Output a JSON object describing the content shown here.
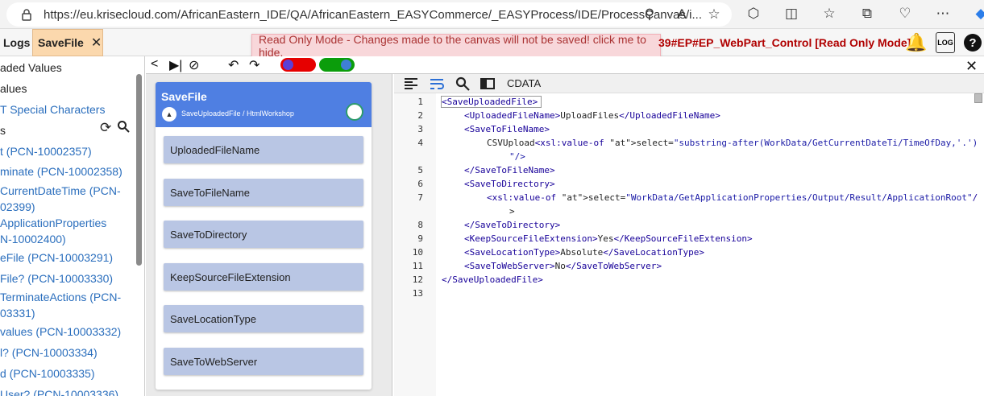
{
  "browser": {
    "url": "https://eu.krisecloud.com/AfricanEastern_IDE/QA/AfricanEastern_EASYCommerce/_EASYProcess/IDE/ProcessCanvas/i..."
  },
  "tabs": {
    "logs": "Logs",
    "savefile": "SaveFile",
    "close": "✕"
  },
  "banner": {
    "message": "Read Only Mode - Changes made to the canvas will not be saved! click me to hide.",
    "title_suffix": "39#EP#EP_WebPart_Control [Read Only Mode]"
  },
  "sidebar": {
    "items": [
      "aded Values",
      "alues",
      "T Special Characters",
      "s",
      "t (PCN-10002357)",
      "minate (PCN-10002358)",
      "CurrentDateTime (PCN-",
      "02399)",
      "ApplicationProperties",
      "N-10002400)",
      "eFile (PCN-10003291)",
      "File? (PCN-10003330)",
      "TerminateActions (PCN-",
      "03331)",
      "values (PCN-10003332)",
      "l? (PCN-10003334)",
      "d (PCN-10003335)",
      "User? (PCN-10003336)"
    ]
  },
  "node": {
    "title": "SaveFile",
    "subtitle": "SaveUploadedFile / HtmlWorkshop",
    "fields": [
      "UploadedFileName",
      "SaveToFileName",
      "SaveToDirectory",
      "KeepSourceFileExtension",
      "SaveLocationType",
      "SaveToWebServer"
    ]
  },
  "editor": {
    "cdata_label": "CDATA",
    "line_numbers": [
      "1",
      "2",
      "3",
      "4",
      "",
      "5",
      "6",
      "7",
      "",
      "8",
      "9",
      "10",
      "11",
      "12",
      "13"
    ],
    "lines": [
      {
        "t": "<SaveUploadedFile>",
        "i": 0
      },
      {
        "t": "<UploadedFileName>UploadFiles</UploadedFileName>",
        "i": 1
      },
      {
        "t": "<SaveToFileName>",
        "i": 1
      },
      {
        "t": "CSVUpload<xsl:value-of select=\"substring-after(WorkData/GetCurrentDateTi/TimeOfDay,'.')",
        "i": 2
      },
      {
        "t": "\"/>",
        "i": 3
      },
      {
        "t": "</SaveToFileName>",
        "i": 1
      },
      {
        "t": "<SaveToDirectory>",
        "i": 1
      },
      {
        "t": "<xsl:value-of select=\"WorkData/GetApplicationProperties/Output/Result/ApplicationRoot\"/",
        "i": 2
      },
      {
        "t": ">",
        "i": 3
      },
      {
        "t": "</SaveToDirectory>",
        "i": 1
      },
      {
        "t": "<KeepSourceFileExtension>Yes</KeepSourceFileExtension>",
        "i": 1
      },
      {
        "t": "<SaveLocationType>Absolute</SaveLocationType>",
        "i": 1
      },
      {
        "t": "<SaveToWebServer>No</SaveToWebServer>",
        "i": 1
      },
      {
        "t": "</SaveUploadedFile>",
        "i": 0
      },
      {
        "t": "",
        "i": 0
      }
    ]
  },
  "colors": {
    "accent": "#4f7fe2",
    "readonly_bg": "#f8d7da",
    "tab_active": "#fbd8ad",
    "link": "#2a6ebd"
  },
  "icons": [
    "lock-icon",
    "zoom-icon",
    "read-aloud-icon",
    "favorite-star-icon",
    "extensions-icon",
    "split-screen-icon",
    "favorites-icon",
    "collections-icon",
    "health-icon",
    "more-icon",
    "copilot-icon",
    "bell-icon",
    "log-icon",
    "help-icon"
  ]
}
